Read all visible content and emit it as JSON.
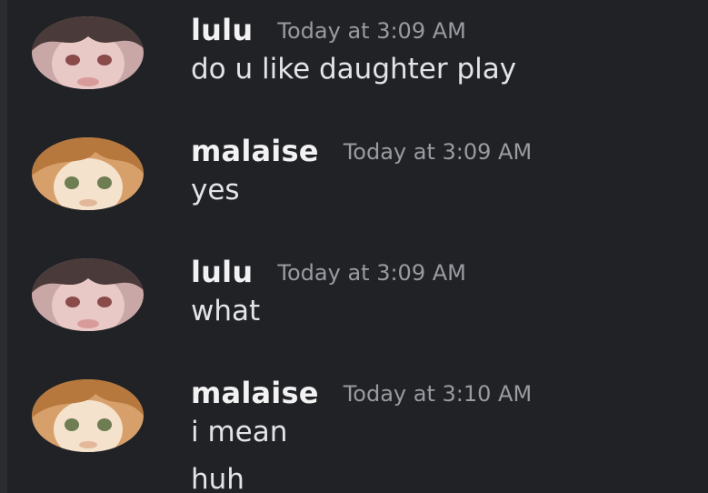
{
  "messages": [
    {
      "username": "lulu",
      "timestamp": "Today at 3:09 AM",
      "lines": [
        "do u like daughter play"
      ],
      "avatar_icon": "dark-haired-anime-girl-avatar"
    },
    {
      "username": "malaise",
      "timestamp": "Today at 3:09 AM",
      "lines": [
        "yes"
      ],
      "avatar_icon": "brown-haired-anime-girl-avatar"
    },
    {
      "username": "lulu",
      "timestamp": "Today at 3:09 AM",
      "lines": [
        "what"
      ],
      "avatar_icon": "dark-haired-anime-girl-avatar"
    },
    {
      "username": "malaise",
      "timestamp": "Today at 3:10 AM",
      "lines": [
        "i mean",
        "huh"
      ],
      "avatar_icon": "brown-haired-anime-girl-avatar"
    }
  ],
  "colors": {
    "background": "#212226",
    "username": "#f2f2f3",
    "timestamp": "#9a9ba1",
    "message_text": "#e3e4e7"
  }
}
